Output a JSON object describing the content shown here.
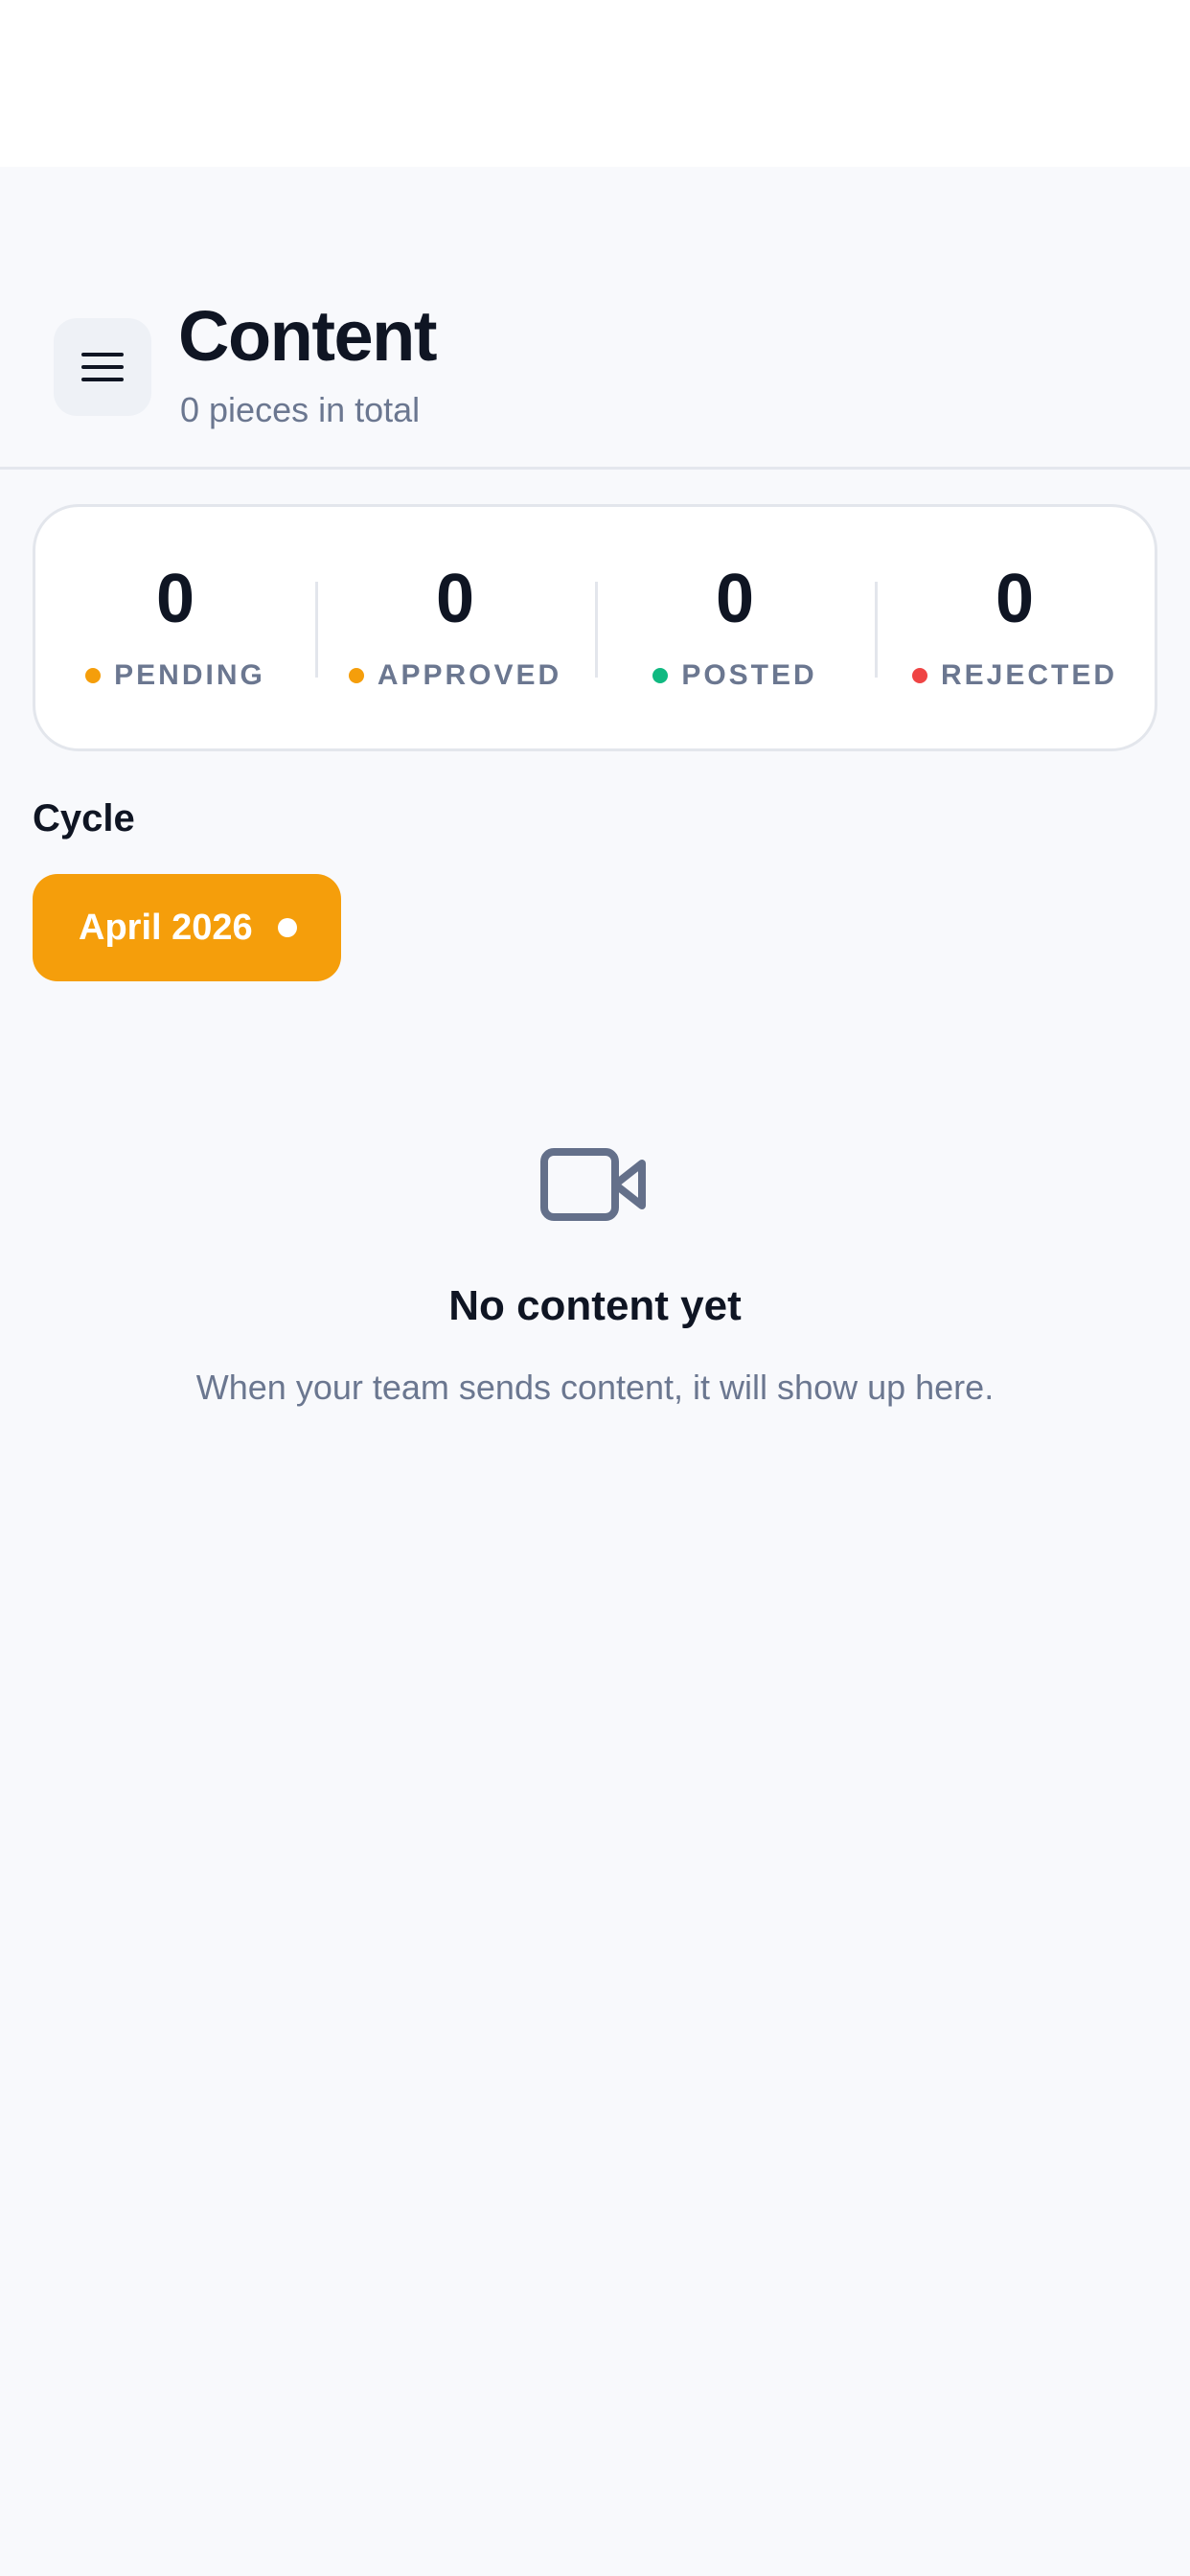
{
  "header": {
    "title": "Content",
    "subtitle": "0 pieces in total",
    "menu_icon": "hamburger-menu-icon"
  },
  "stats": [
    {
      "value": "0",
      "label": "PENDING",
      "color": "#f59e0b"
    },
    {
      "value": "0",
      "label": "APPROVED",
      "color": "#f59e0b"
    },
    {
      "value": "0",
      "label": "POSTED",
      "color": "#10b981"
    },
    {
      "value": "0",
      "label": "REJECTED",
      "color": "#ef4444"
    }
  ],
  "cycle": {
    "section_label": "Cycle",
    "selected": "April 2026",
    "chip_color": "#f59e0b"
  },
  "empty_state": {
    "icon": "video-camera-icon",
    "title": "No content yet",
    "description": "When your team sends content, it will show up here."
  },
  "colors": {
    "text_primary": "#0f1523",
    "text_muted": "#6b7790",
    "icon_muted": "#64708a"
  }
}
